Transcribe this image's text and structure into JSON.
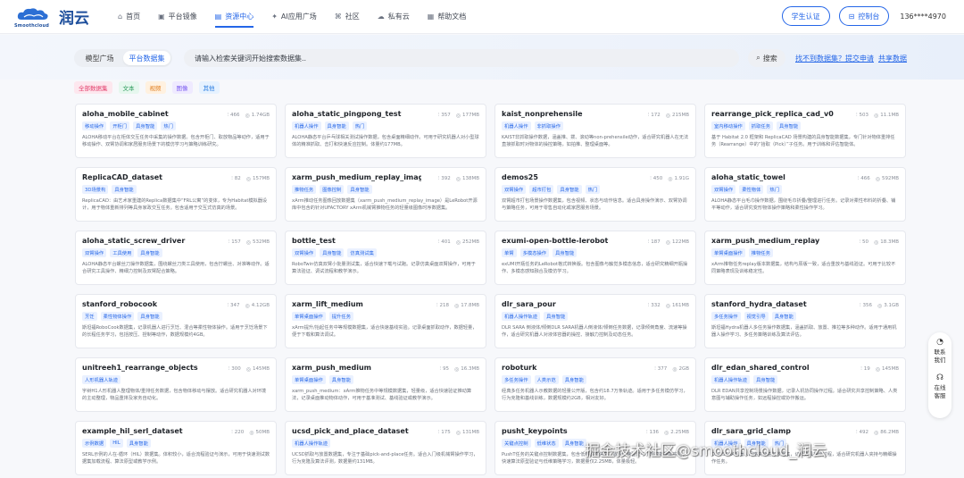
{
  "brand": {
    "name": "润云",
    "sub": "Smoothcloud"
  },
  "nav": [
    {
      "label": "首页",
      "icon": "home-icon",
      "glyph": "⌂"
    },
    {
      "label": "平台镜像",
      "icon": "cube-icon",
      "glyph": "▣"
    },
    {
      "label": "资源中心",
      "icon": "database-icon",
      "glyph": "▤"
    },
    {
      "label": "AI应用广场",
      "icon": "sparkle-icon",
      "glyph": "✦"
    },
    {
      "label": "社区",
      "icon": "community-icon",
      "glyph": "⌘"
    },
    {
      "label": "私有云",
      "icon": "cloud-icon",
      "glyph": "☁"
    },
    {
      "label": "帮助文档",
      "icon": "doc-icon",
      "glyph": "▦"
    }
  ],
  "header_right": {
    "cert": "学生认证",
    "console": "控制台",
    "user": "136****4970"
  },
  "segment": {
    "model": "模型广场",
    "dataset": "平台数据集"
  },
  "search": {
    "placeholder": "请输入检索关键词开始搜索数据集..",
    "button": "搜索"
  },
  "links": {
    "request": "找不到数据集？提交申请",
    "share": "共享数据"
  },
  "filters": [
    {
      "label": "全部数据集",
      "bg": "#fde7ee",
      "fg": "#e23c6a"
    },
    {
      "label": "文本",
      "bg": "#e6f7ee",
      "fg": "#2b9a5a"
    },
    {
      "label": "视频",
      "bg": "#fff1e0",
      "fg": "#e07b1a"
    },
    {
      "label": "图像",
      "bg": "#efeaff",
      "fg": "#7a5af0"
    },
    {
      "label": "其他",
      "bg": "#e6f2ff",
      "fg": "#2a7de1"
    }
  ],
  "datasets": [
    {
      "title": "aloha_mobile_cabinet",
      "count": "466",
      "size": "1.74GB",
      "tags": [
        "移动操作",
        "开柜门",
        "具身智能",
        "热门"
      ],
      "desc": "ALOHA移动平台在柜体交互任务中采集的操作数据。包含开柜门、取放物品等动作，适用于移动操作、双臂协调和家居服务场景下的模仿学习与策略训练研究。"
    },
    {
      "title": "aloha_static_pingpong_test",
      "count": "357",
      "size": "177MB",
      "tags": [
        "机器人操作",
        "具身智能",
        "热门"
      ],
      "desc": "ALOHA静态平台乒乓球相关测试操作数据，包含桌面精细动作。可用于研究机器人对小型球体的精准抓取、击打和快速反应控制。体量约177MB。"
    },
    {
      "title": "kaist_nonprehensile",
      "count": "172",
      "size": "215MB",
      "tags": [
        "机器人操作",
        "非抓取操作"
      ],
      "desc": "KAIST非抓取操作数据，涵盖推、拨、滚动等non-prehensile动作，适合研究机器人在无法直接抓取时对物体的操控策略，如拍推、整理桌面等。"
    },
    {
      "title": "rearrange_pick_replica_cad_v0",
      "count": "503",
      "size": "11.1MB",
      "tags": [
        "室内移动操作",
        "抓取任务",
        "具身智能"
      ],
      "desc": "基于 Habitat 2.0 框架和 ReplicaCAD 场景构建的具身智能数据集，专门针对物体重排任务（Rearrange）中的“拾取（Pick）”子任务。用于训练和评估智能体。"
    },
    {
      "title": "ReplicaCAD_dataset",
      "count": "82",
      "size": "157MB",
      "tags": [
        "3D场景构",
        "具身智能"
      ],
      "desc": "ReplicaCAD：由艺术家重建的Replica数据集中“FRL公寓”的变体，专为Habitat模拟器设计，用于物体重新排列等具身家政交互任务。包含适用于交互式仿真的场景。"
    },
    {
      "title": "xarm_push_medium_replay_image",
      "count": "392",
      "size": "138MB",
      "tags": [
        "推物任务",
        "图像控制",
        "具身智能"
      ],
      "desc": "xArm推动任务图像回放数据集（xarm_push_medium_replay_image）是LeRobot开源库中包含的针对UFACTORY xArm机械臂推物任务的轻量级图像时序数据集。"
    },
    {
      "title": "demos25",
      "count": "450",
      "size": "1.91G",
      "tags": [
        "双臂操作",
        "超市打包",
        "具身智能",
        "热门"
      ],
      "desc": "双臂超市打包场景操作数据集，包含视频、状态与动作信息。适合具身操作演示、双臂协调与策略任务，可用于零售自动化或家居服务场景。"
    },
    {
      "title": "aloha_static_towel",
      "count": "466",
      "size": "592MB",
      "tags": [
        "双臂操作",
        "柔性物体",
        "热门"
      ],
      "desc": "ALOHA静态平台毛巾操作数据，围绕毛巾折叠/整理进行任务。记录对柔性布料的折叠、铺平等动作，适合研究变形物体操作策略和柔性操作学习。"
    },
    {
      "title": "aloha_static_screw_driver",
      "count": "157",
      "size": "532MB",
      "tags": [
        "双臂操作",
        "工具使用",
        "具身智能"
      ],
      "desc": "ALOHA静态平台螺丝刀操作数据集，围绕螺丝刀类工具使用，包含拧螺丝、对准等动作。适合研究工具操作、精细力控制及双臂配合策略。"
    },
    {
      "title": "bottle_test",
      "count": "401",
      "size": "252MB",
      "tags": [
        "双臂操作",
        "具身智能",
        "仿真测试集"
      ],
      "desc": "RoboTwin仿真双臂小批量测试集，适合快速下载与试跑。记录仿真桌面双臂操作，可用于算法验证、调试流程和教学演示。"
    },
    {
      "title": "exumi-open-bottle-lerobot",
      "count": "187",
      "size": "122MB",
      "tags": [
        "单臂",
        "多模态操作",
        "具身智能"
      ],
      "desc": "exUMI开瓶任务的LeRobot格式转换版。包含图像与触觉多模态信息，适合研究精细开瓶操作、多模态感知融合及模仿学习。"
    },
    {
      "title": "xarm_push_medium_replay",
      "count": "50",
      "size": "18.3MB",
      "tags": [
        "单臂桌面操作",
        "推物任务"
      ],
      "desc": "xArm推物任务replay版本数据集，结构与原版一致，适合重放与基线验证。可用于比较不同策略表现及训练稳定性。"
    },
    {
      "title": "stanford_robocook",
      "count": "347",
      "size": "4.12GB",
      "tags": [
        "烹饪",
        "柔性物体操作",
        "具身智能"
      ],
      "desc": "斯坦福RoboCook数据集，记录机器人进行烹饪、混合等柔性物体操作。适用于烹饪场景下的长程任务学习，包括按压、捏制等动作，数据规模约4GB。"
    },
    {
      "title": "xarm_lift_medium",
      "count": "218",
      "size": "17.8MB",
      "tags": [
        "单臂桌面操作",
        "提升任务"
      ],
      "desc": "xArm提升/抬起任务中等规模数据集，适合快速基线实验。记录桌面抓取动作，数据轻量，便于下载和算法调试。"
    },
    {
      "title": "dlr_sara_pour",
      "count": "332",
      "size": "161MB",
      "tags": [
        "机器人操作轨迹",
        "具身智能"
      ],
      "desc": "DLR SARA 倒液体/倾倒DLR SARA机器人倒液体/倾倒任务数据，记录倾倒角度、流速等操作，适合研究机器人对液体容器的操控、接触力控制及动态任务。"
    },
    {
      "title": "stanford_hydra_dataset",
      "count": "356",
      "size": "3.1GB",
      "tags": [
        "多任务操作",
        "视觉引导",
        "具身智能"
      ],
      "desc": "斯坦福Hydra机器人多任务操作数据集，涵盖抓取、放置、推拉等多种动作。适用于通用机器人操作学习、多任务策略训练及算法评估。"
    },
    {
      "title": "unitreeh1_rearrange_objects",
      "count": "300",
      "size": "145MB",
      "tags": [
        "人形机器人轨迹"
      ],
      "desc": "宇树H1人形机器人整理物体/重排任务数据，包含物体移动与摆放。适合研究机器人对环境的主动整理，物品重排及家务自动化。"
    },
    {
      "title": "xarm_push_medium",
      "count": "95",
      "size": "16.3MB",
      "tags": [
        "单臂桌面操作",
        "具身智能"
      ],
      "desc": "xarm_push_medium：xArm推物任务中等规模数据集，轻量级，适合快速验证推动算法，记录桌面推动物体动作，可用于基准测试、基线验证或教学演示。"
    },
    {
      "title": "roboturk",
      "count": "377",
      "size": "2GB",
      "tags": [
        "多任务操作",
        "人类示范",
        "具身智能"
      ],
      "desc": "经典多任务机器人示教数据的轻量公开版，包含约18.7万条轨迹。适用于多任务模仿学习，行为克隆和基线训练，数据规模约2GB，相对友好。"
    },
    {
      "title": "dlr_edan_shared_control",
      "count": "19",
      "size": "145MB",
      "tags": [
        "机器人操作轨迹",
        "具身智能"
      ],
      "desc": "DLR EDAN共享控制场景操作数据，记录人机协同操作过程。适合研究共享控制策略、人类意图与辅助操作任务，如远程操控或协作搬运。"
    },
    {
      "title": "example_hil_serl_dataset",
      "count": "220",
      "size": "50MB",
      "tags": [
        "示例数据",
        "HIL",
        "具身智能"
      ],
      "desc": "SERL示例的人在-循环（HIL）数据集。体积较小，适合流程验证与演示，可用于快速测试数据集加载流程、算法原型或教学示例。"
    },
    {
      "title": "ucsd_pick_and_place_dataset",
      "count": "175",
      "size": "131MB",
      "tags": [
        "机器人操作轨迹"
      ],
      "desc": "UCSD抓取与放置数据集，专注于基础pick-and-place任务。适合入门级机械臂操作学习，行为克隆及算法评测，数据量约131MB。"
    },
    {
      "title": "pusht_keypoints",
      "count": "136",
      "size": "2.25MB",
      "tags": [
        "关键点控制",
        "低维状态",
        "具身智能"
      ],
      "desc": "PushT任务的关键点控制数据集，包含低维状态信息。适合快速验证与小规模数据集实验，快速算法原型验证与低维策略学习，数据量仅2.25MB，体量极轻。"
    },
    {
      "title": "dlr_sara_grid_clamp",
      "count": "492",
      "size": "86.2MB",
      "tags": [
        "机器人操作",
        "具身智能",
        "热门"
      ],
      "desc": "DLR SARA机器人网格夹持任务数据集，记录夹具操作过程，适合研究机器人夹持与精细操作任务。"
    }
  ],
  "side_widget": {
    "contact": "联系我们",
    "online": "在线客服"
  },
  "watermark": "掘金技术社区@smoothcloud_润云"
}
